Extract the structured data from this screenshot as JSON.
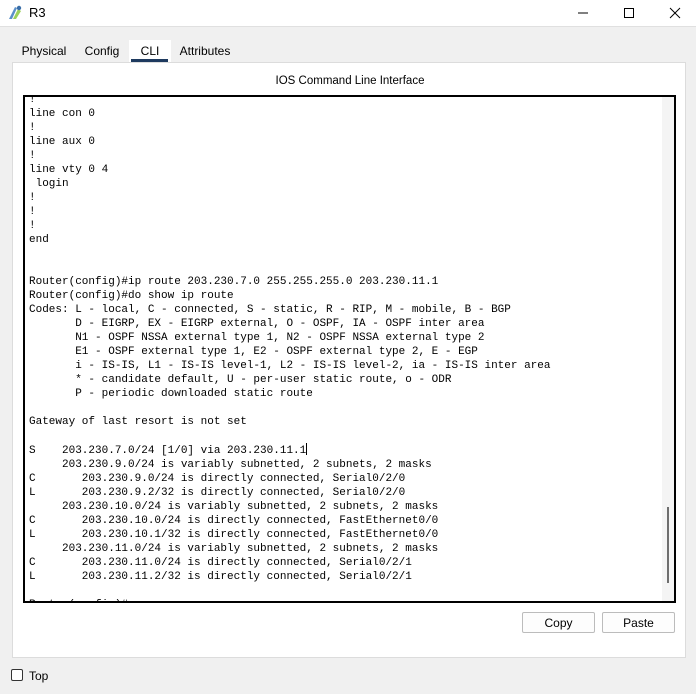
{
  "window": {
    "title": "R3",
    "app_icon": "packet-tracer-router-icon",
    "controls": {
      "minimize": "minimize-icon",
      "maximize": "maximize-icon",
      "close": "close-icon"
    }
  },
  "tabs": [
    {
      "label": "Physical",
      "active": false
    },
    {
      "label": "Config",
      "active": false
    },
    {
      "label": "CLI",
      "active": true
    },
    {
      "label": "Attributes",
      "active": false
    }
  ],
  "panel": {
    "title": "IOS Command Line Interface"
  },
  "terminal": {
    "lines_before_cursor": "!\nline con 0\n!\nline aux 0\n!\nline vty 0 4\n login\n!\n!\n!\nend\n\n\nRouter(config)#ip route 203.230.7.0 255.255.255.0 203.230.11.1\nRouter(config)#do show ip route\nCodes: L - local, C - connected, S - static, R - RIP, M - mobile, B - BGP\n       D - EIGRP, EX - EIGRP external, O - OSPF, IA - OSPF inter area\n       N1 - OSPF NSSA external type 1, N2 - OSPF NSSA external type 2\n       E1 - OSPF external type 1, E2 - OSPF external type 2, E - EGP\n       i - IS-IS, L1 - IS-IS level-1, L2 - IS-IS level-2, ia - IS-IS inter area\n       * - candidate default, U - per-user static route, o - ODR\n       P - periodic downloaded static route\n\nGateway of last resort is not set\n\nS    203.230.7.0/24 [1/0] via 203.230.11.1",
    "lines_after_cursor": "\n     203.230.9.0/24 is variably subnetted, 2 subnets, 2 masks\nC       203.230.9.0/24 is directly connected, Serial0/2/0\nL       203.230.9.2/32 is directly connected, Serial0/2/0\n     203.230.10.0/24 is variably subnetted, 2 subnets, 2 masks\nC       203.230.10.0/24 is directly connected, FastEthernet0/0\nL       203.230.10.1/32 is directly connected, FastEthernet0/0\n     203.230.11.0/24 is variably subnetted, 2 subnets, 2 masks\nC       203.230.11.0/24 is directly connected, Serial0/2/1\nL       203.230.11.2/32 is directly connected, Serial0/2/1\n\nRouter(config)#"
  },
  "buttons": {
    "copy": "Copy",
    "paste": "Paste"
  },
  "footer": {
    "top_label": "Top",
    "top_checked": false
  }
}
